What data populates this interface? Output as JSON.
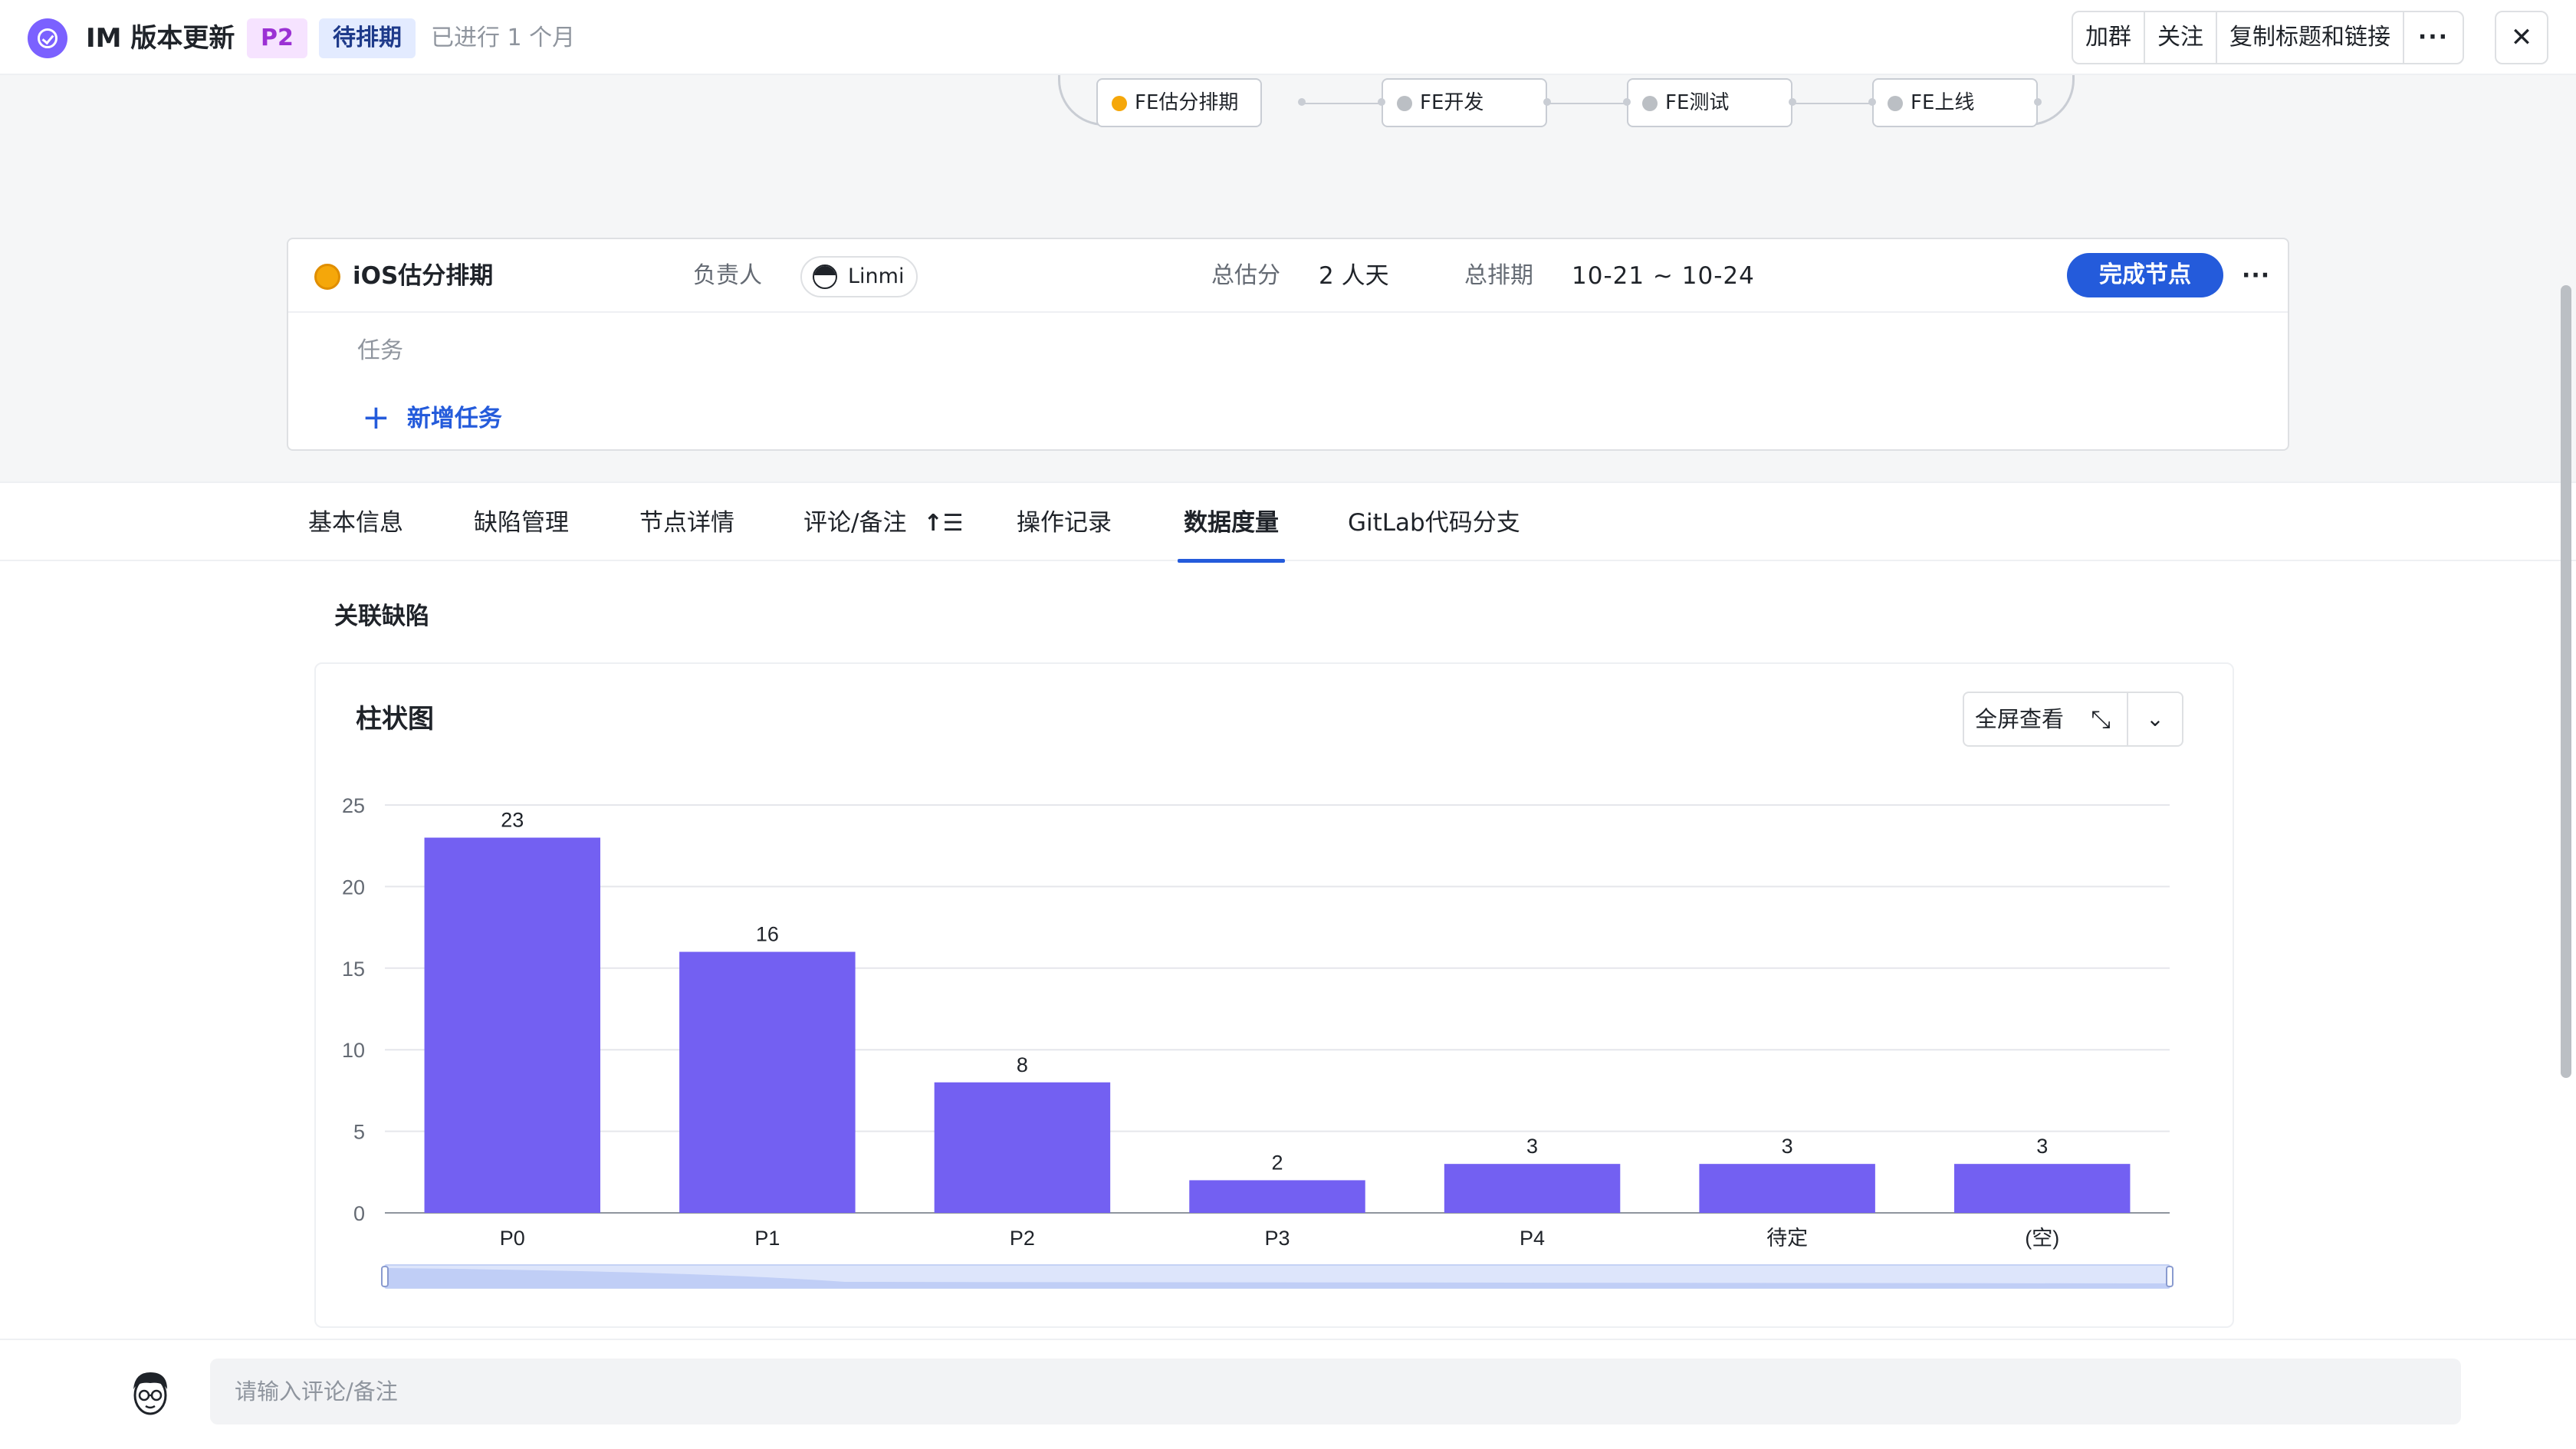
{
  "header": {
    "title": "IM 版本更新",
    "priority": "P2",
    "status": "待排期",
    "elapsed": "已进行 1 个月",
    "actions": [
      "加群",
      "关注",
      "复制标题和链接"
    ],
    "more": "···",
    "close": "✕"
  },
  "workflow": {
    "nodes": [
      {
        "label": "FE估分排期",
        "active": true
      },
      {
        "label": "FE开发",
        "active": false
      },
      {
        "label": "FE测试",
        "active": false
      },
      {
        "label": "FE上线",
        "active": false
      }
    ]
  },
  "node_card": {
    "name": "iOS估分排期",
    "owner_label": "负责人",
    "owner": "Linmi",
    "estimate_label": "总估分",
    "estimate": "2 人天",
    "schedule_label": "总排期",
    "schedule": "10-21 ~ 10-24",
    "complete_button": "完成节点",
    "more": "···",
    "task_label": "任务",
    "add_task": "新增任务",
    "add_icon": "+"
  },
  "tabs": [
    {
      "label": "基本信息"
    },
    {
      "label": "缺陷管理"
    },
    {
      "label": "节点详情"
    },
    {
      "label": "评论/备注"
    },
    {
      "label": "操作记录"
    },
    {
      "label": "数据度量",
      "active": true
    },
    {
      "label": "GitLab代码分支"
    }
  ],
  "section": {
    "title": "关联缺陷",
    "chart_title": "柱状图",
    "fullscreen": "全屏查看",
    "expand_icon": "⤡",
    "dropdown_icon": "⌄"
  },
  "chart_data": {
    "type": "bar",
    "title": "柱状图",
    "categories": [
      "P0",
      "P1",
      "P2",
      "P3",
      "P4",
      "待定",
      "(空)"
    ],
    "values": [
      23,
      16,
      8,
      2,
      3,
      3,
      3
    ],
    "yticks": [
      0,
      5,
      10,
      15,
      20,
      25
    ],
    "ylim": [
      0,
      25
    ],
    "grid": true,
    "bar_color": "#7360f2",
    "data_labels": true
  },
  "footer": {
    "comment_placeholder": "请输入评论/备注"
  },
  "colors": {
    "accent": "#245bdb",
    "app_icon": "#7b61ff",
    "active_node": "#f5a70a"
  }
}
